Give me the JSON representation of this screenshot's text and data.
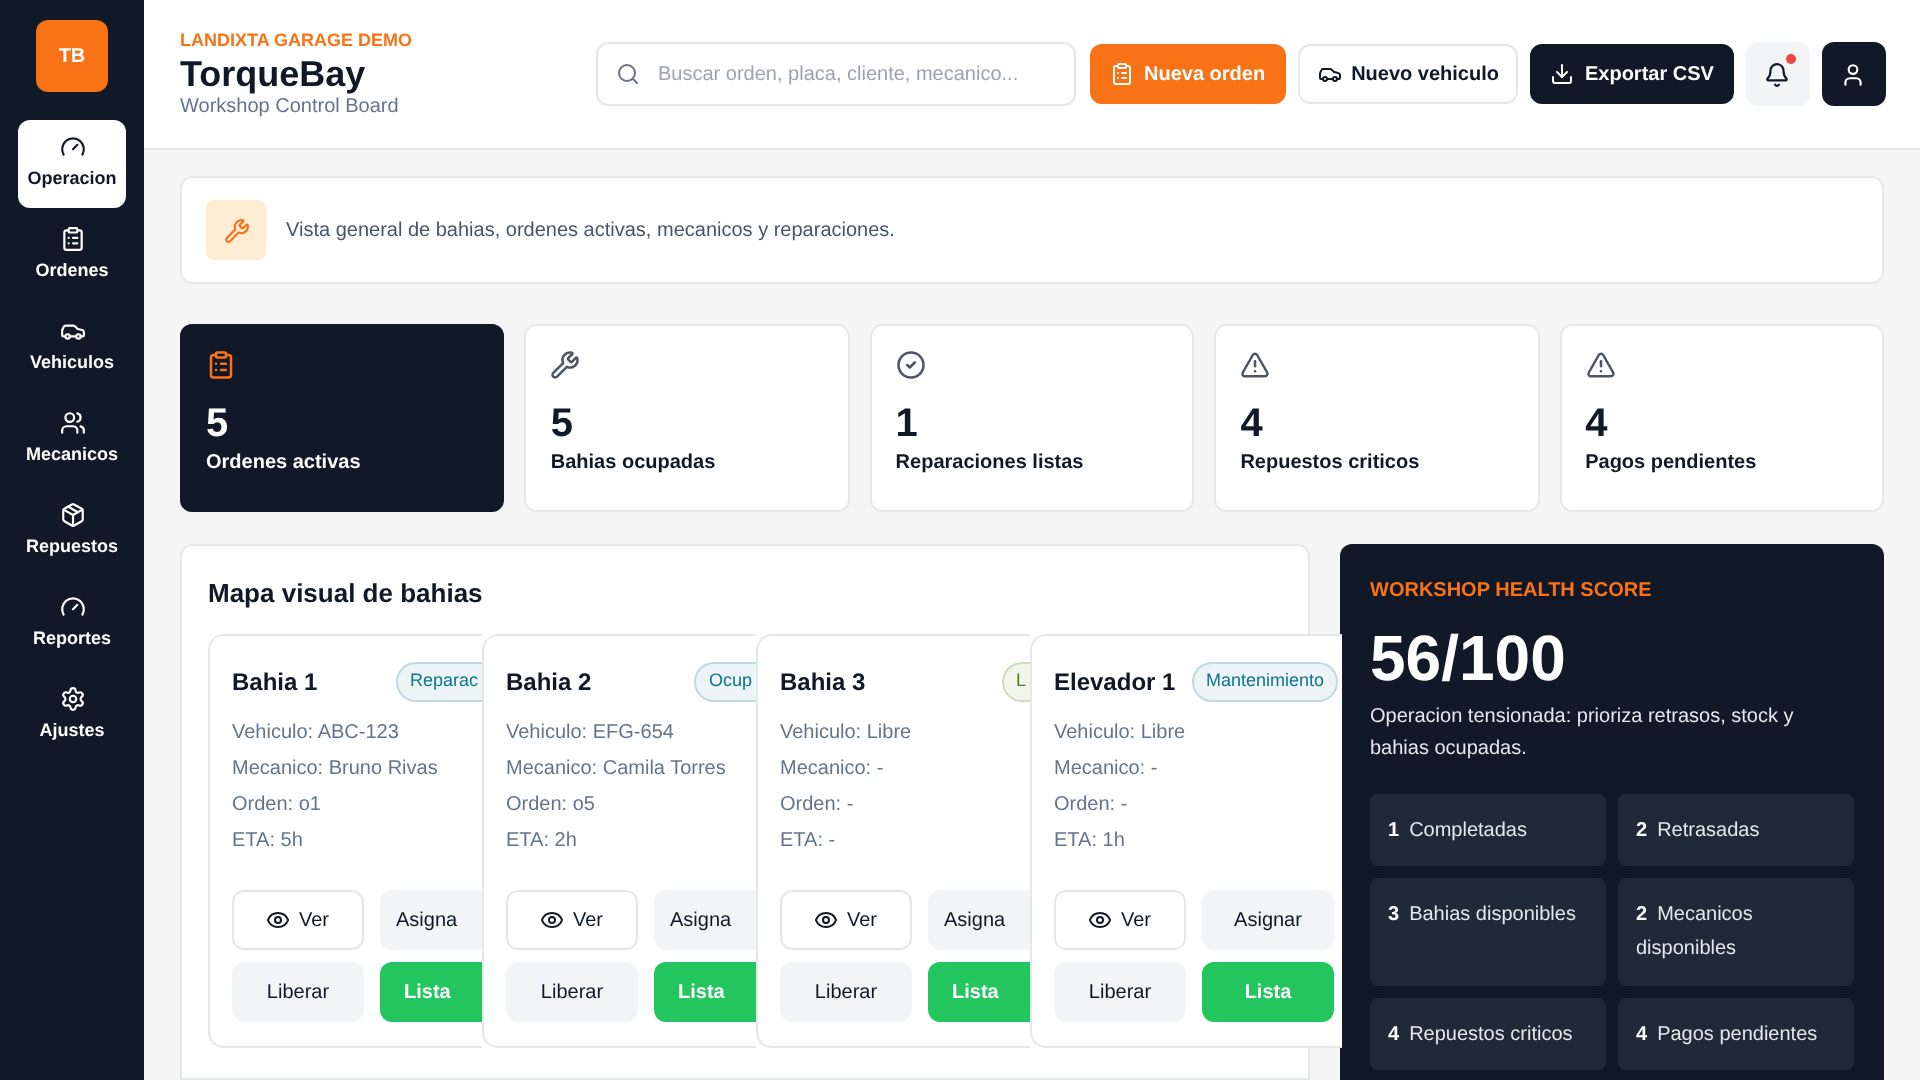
{
  "sidebar": {
    "logo": "TB",
    "items": [
      {
        "label": "Operacion",
        "selected": true
      },
      {
        "label": "Ordenes",
        "selected": false
      },
      {
        "label": "Vehiculos",
        "selected": false
      },
      {
        "label": "Mecanicos",
        "selected": false
      },
      {
        "label": "Repuestos",
        "selected": false
      },
      {
        "label": "Reportes",
        "selected": false
      },
      {
        "label": "Ajustes",
        "selected": false
      }
    ]
  },
  "header": {
    "eyebrow": "LANDIXTA GARAGE DEMO",
    "title": "TorqueBay",
    "subtitle": "Workshop Control Board",
    "search": {
      "placeholder": "Buscar orden, placa, cliente, mecanico..."
    },
    "buttons": [
      {
        "label": "Nueva orden",
        "kind": "primary"
      },
      {
        "label": "Nuevo vehiculo",
        "kind": "outline"
      },
      {
        "label": "Exportar CSV",
        "kind": "dark"
      }
    ],
    "notifications": {
      "unread": true
    }
  },
  "intro": "Vista general de bahias, ordenes activas, mecanicos y reparaciones.",
  "stats": [
    {
      "value": "5",
      "label": "Ordenes activas",
      "selected": true
    },
    {
      "value": "5",
      "label": "Bahias ocupadas",
      "selected": false
    },
    {
      "value": "1",
      "label": "Reparaciones listas",
      "selected": false
    },
    {
      "value": "4",
      "label": "Repuestos criticos",
      "selected": false
    },
    {
      "value": "4",
      "label": "Pagos pendientes",
      "selected": false
    }
  ],
  "bay_map": {
    "title": "Mapa visual de bahias",
    "bays": [
      {
        "name": "Bahia 1",
        "status": "Reparac",
        "color": "#0e7490",
        "lines": [
          "Vehiculo: ABC-123",
          "Mecanico: Bruno Rivas",
          "Orden: o1",
          "ETA: 5h"
        ],
        "actions": [
          "Ver",
          "Asigna",
          "Liberar",
          "Lista"
        ]
      },
      {
        "name": "Bahia 2",
        "status": "Ocup",
        "color": "#0e7490",
        "lines": [
          "Vehiculo: EFG-654",
          "Mecanico: Camila Torres",
          "Orden: o5",
          "ETA: 2h"
        ],
        "actions": [
          "Ver",
          "Asigna",
          "Liberar",
          "Lista"
        ]
      },
      {
        "name": "Bahia 3",
        "status": "L",
        "color": "#4d7c0f",
        "lines": [
          "Vehiculo: Libre",
          "Mecanico: -",
          "Orden: -",
          "ETA: -"
        ],
        "actions": [
          "Ver",
          "Asigna",
          "Liberar",
          "Lista"
        ]
      },
      {
        "name": "Elevador 1",
        "status": "Mantenimiento",
        "color": "#0e7490",
        "lines": [
          "Vehiculo: Libre",
          "Mecanico: -",
          "Orden: -",
          "ETA: 1h"
        ],
        "actions": [
          "Ver",
          "Asignar",
          "Liberar",
          "Lista"
        ]
      }
    ]
  },
  "health": {
    "title": "WORKSHOP HEALTH SCORE",
    "score": "56/100",
    "summary": "Operacion tensionada: prioriza retrasos, stock y bahias ocupadas.",
    "metrics": [
      {
        "value": "1",
        "label": "Completadas"
      },
      {
        "value": "2",
        "label": "Retrasadas"
      },
      {
        "value": "3",
        "label": "Bahias disponibles"
      },
      {
        "value": "2",
        "label": "Mecanicos disponibles"
      },
      {
        "value": "4",
        "label": "Repuestos criticos"
      },
      {
        "value": "4",
        "label": "Pagos pendientes"
      }
    ]
  }
}
